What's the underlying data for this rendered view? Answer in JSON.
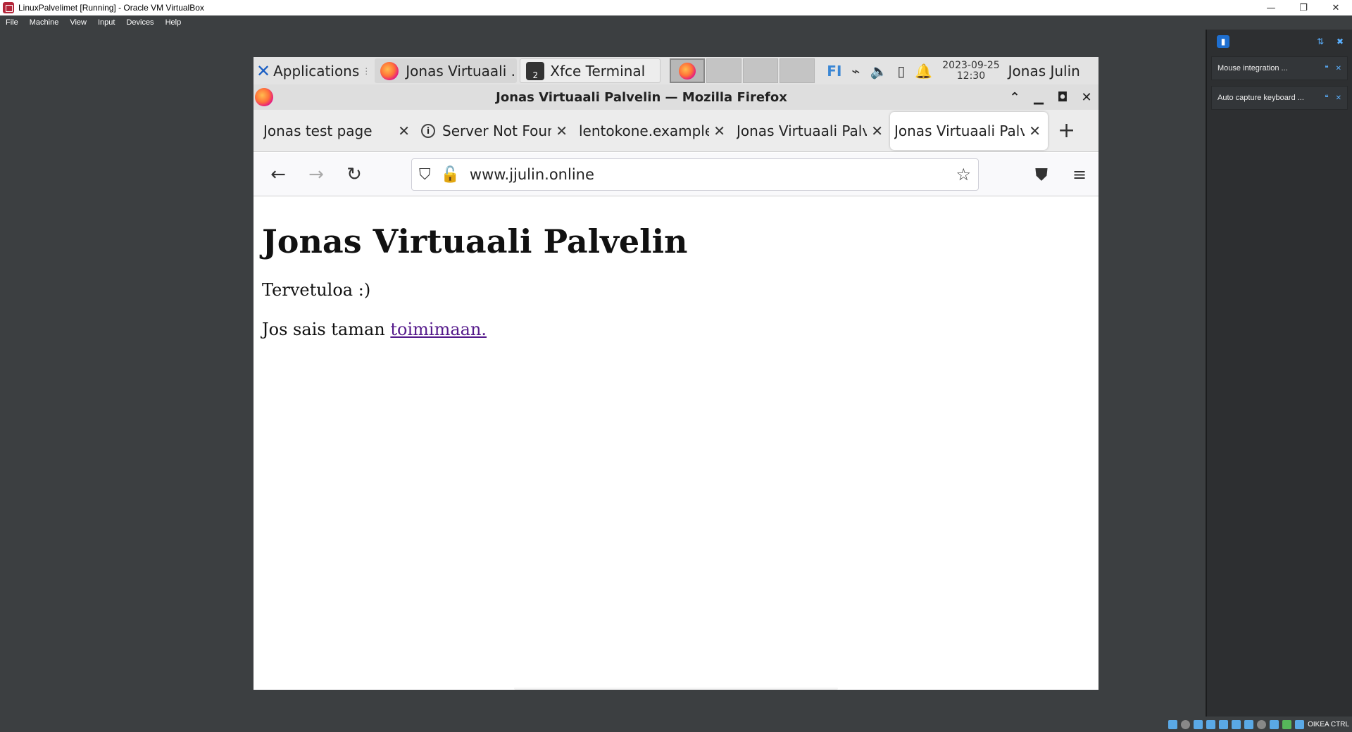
{
  "host": {
    "title": "LinuxPalvelimet [Running] - Oracle VM VirtualBox",
    "menu": [
      "File",
      "Machine",
      "View",
      "Input",
      "Devices",
      "Help"
    ],
    "controls": {
      "minimize": "—",
      "restore": "❐",
      "close": "✕"
    },
    "notifications": [
      {
        "text": "Mouse integration ..."
      },
      {
        "text": "Auto capture keyboard ..."
      }
    ],
    "status_label": "OIKEA CTRL"
  },
  "xfce": {
    "applications_label": "Applications",
    "tasks": [
      {
        "label": "Jonas Virtuaali ...",
        "icon": "firefox-icon"
      },
      {
        "label": "Xfce Terminal",
        "icon": "terminal-icon",
        "badge": "2"
      }
    ],
    "keyboard_layout": "FI",
    "date": "2023-09-25",
    "time": "12:30",
    "user": "Jonas Julin"
  },
  "firefox": {
    "window_title": "Jonas Virtuaali Palvelin — Mozilla Firefox",
    "tabs": [
      {
        "label": "Jonas test page"
      },
      {
        "label": "Server Not Found"
      },
      {
        "label": "lentokone.example"
      },
      {
        "label": "Jonas Virtuaali Palvelin"
      },
      {
        "label": "Jonas Virtuaali Palvelin"
      }
    ],
    "selected_tab": 4,
    "url": "www.jjulin.online"
  },
  "page": {
    "heading": "Jonas Virtuaali Palvelin",
    "greeting": "Tervetuloa :)",
    "line_prefix": "Jos sais taman ",
    "link_text": "toimimaan."
  },
  "colors": {
    "link": "#551a8b",
    "xfce_accent": "#1b5fc4",
    "vbox_accent": "#5ab0ff"
  }
}
